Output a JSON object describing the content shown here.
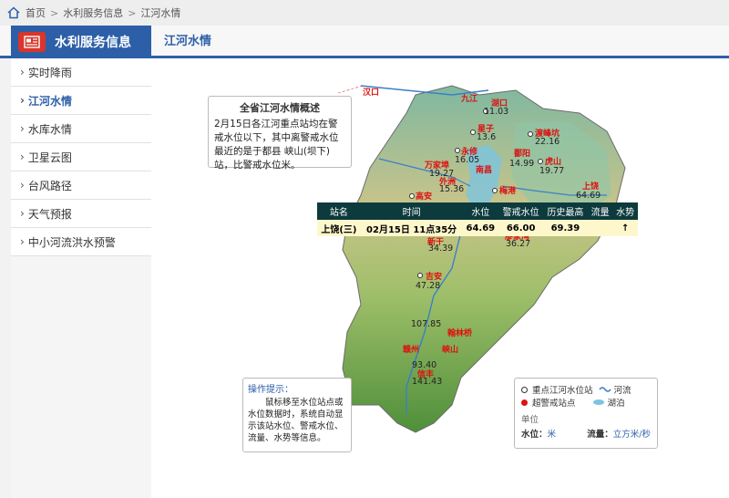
{
  "breadcrumb": {
    "home": "首页",
    "section": "水利服务信息",
    "current": "江河水情"
  },
  "header": {
    "title": "水利服务信息",
    "subtitle": "江河水情"
  },
  "sidebar": {
    "items": [
      {
        "label": "实时降雨"
      },
      {
        "label": "江河水情"
      },
      {
        "label": "水库水情"
      },
      {
        "label": "卫星云图"
      },
      {
        "label": "台风路径"
      },
      {
        "label": "天气预报"
      },
      {
        "label": "中小河流洪水预警"
      }
    ]
  },
  "summary": {
    "title": "全省江河水情概述",
    "text": "2月15日各江河重点站均在警戒水位以下，其中离警戒水位最近的是于都县 峡山(坝下)站，比警戒水位米。"
  },
  "table": {
    "headers": [
      "站名",
      "时间",
      "水位",
      "警戒水位",
      "历史最高",
      "流量",
      "水势"
    ],
    "row": [
      "上饶(三)",
      "02月15日 11点35分",
      "64.69",
      "66.00",
      "69.39",
      "",
      "↑"
    ]
  },
  "hint": {
    "title": "操作提示：",
    "text": "鼠标移至水位站点或水位数据时，系统自动显示该站水位、警戒水位、流量、水势等信息。"
  },
  "legend": {
    "key_station": "重点江河水位站",
    "alarm_station": "超警戒站点",
    "river": "河流",
    "lake": "湖泊",
    "unit_title": "单位",
    "level_label": "水位：",
    "level_unit": "米",
    "flow_label": "流量：",
    "flow_unit": "立方米/秒"
  },
  "map_labels": {
    "hankou": "汉口",
    "jiujiang": "九江",
    "hukou": "湖口",
    "hukou_val": "11.03",
    "xingzi": "星子",
    "xingzi_val": "13.6",
    "dushui": "渡峰坑",
    "dushui_val": "22.16",
    "yongxiu": "永修",
    "yongxiu_val": "16.05",
    "wanjiabu": "万家埠",
    "wanjiabu_val": "19.27",
    "waizhou": "外洲",
    "waizhou_val": "15.36",
    "nanchang": "南昌",
    "poyang": "鄱阳",
    "poyang_val": "14.99",
    "hushan": "虎山",
    "hushan_val": "19.77",
    "meigang": "梅港",
    "gao_an": "高安",
    "gao_an_val": "30.20",
    "shangrao": "上饶",
    "shangrao_val": "64.69",
    "xiajiang": "新干",
    "xiajiang_val": "34.39",
    "lichuan": "廖家湾",
    "lichuan_val": "36.27",
    "ji_an": "吉安",
    "ji_an_val": "47.28",
    "ganzhou": "赣州",
    "jiangxi_val": "107.85",
    "fenggang": "翰林桥",
    "xiashan": "峡山",
    "yudu_val": "93.40",
    "xinfeng": "信丰",
    "xinfeng_val": "141.43"
  },
  "colors": {
    "accent": "#2d5fa8",
    "alarm": "#dd1111",
    "table_head": "#0d3b3d",
    "table_row": "#fff7cc"
  }
}
